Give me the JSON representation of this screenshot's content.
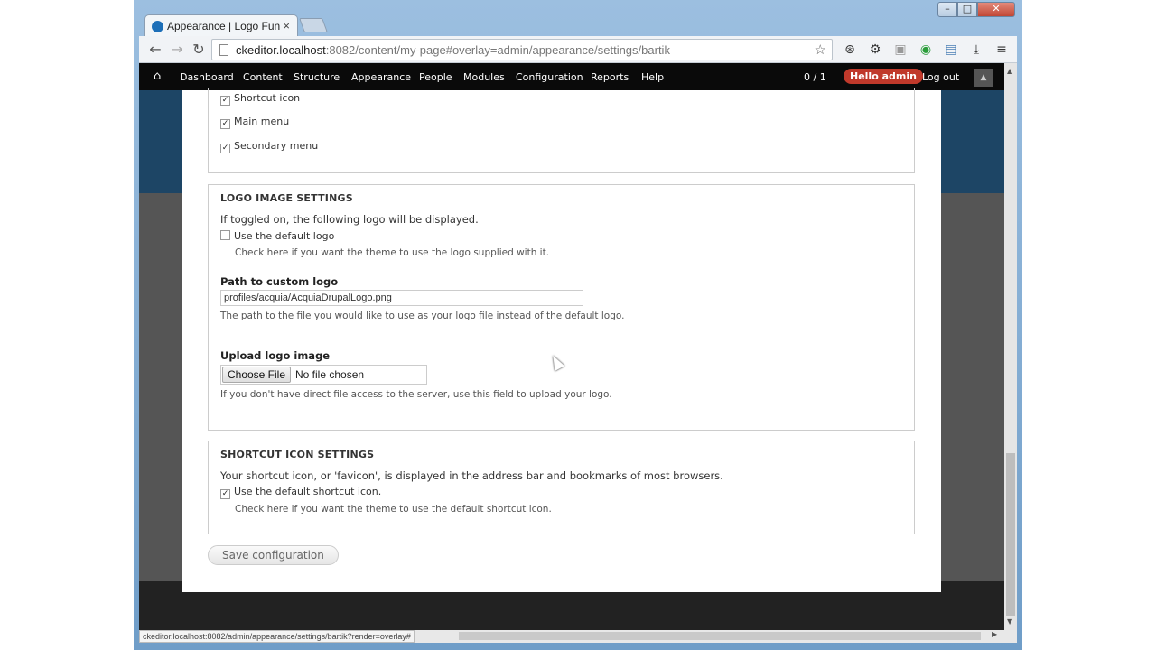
{
  "browser": {
    "tab_title": "Appearance | Logo Fun",
    "tab_close": "×",
    "url_host": "ckeditor.localhost",
    "url_rest": ":8082/content/my-page#overlay=admin/appearance/settings/bartik",
    "status_url": "ckeditor.localhost:8082/admin/appearance/settings/bartik?render=overlay#"
  },
  "adminbar": {
    "items": [
      "Dashboard",
      "Content",
      "Structure",
      "Appearance",
      "People",
      "Modules",
      "Configuration",
      "Reports",
      "Help"
    ],
    "counter": "0 / 1",
    "hello": "Hello admin",
    "logout": "Log out"
  },
  "toggle_display": {
    "items": [
      {
        "label": "Shortcut icon",
        "checked": true
      },
      {
        "label": "Main menu",
        "checked": true
      },
      {
        "label": "Secondary menu",
        "checked": true
      }
    ]
  },
  "logo_settings": {
    "legend": "LOGO IMAGE SETTINGS",
    "intro": "If toggled on, the following logo will be displayed.",
    "default_logo_label": "Use the default logo",
    "default_logo_checked": false,
    "default_logo_desc": "Check here if you want the theme to use the logo supplied with it.",
    "path_label": "Path to custom logo",
    "path_value": "profiles/acquia/AcquiaDrupalLogo.png",
    "path_desc": "The path to the file you would like to use as your logo file instead of the default logo.",
    "upload_label": "Upload logo image",
    "choose_file": "Choose File",
    "no_file": "No file chosen",
    "upload_desc": "If you don't have direct file access to the server, use this field to upload your logo."
  },
  "shortcut_settings": {
    "legend": "SHORTCUT ICON SETTINGS",
    "intro": "Your shortcut icon, or 'favicon', is displayed in the address bar and bookmarks of most browsers.",
    "default_label": "Use the default shortcut icon.",
    "default_checked": true,
    "default_desc": "Check here if you want the theme to use the default shortcut icon."
  },
  "save_label": "Save configuration"
}
